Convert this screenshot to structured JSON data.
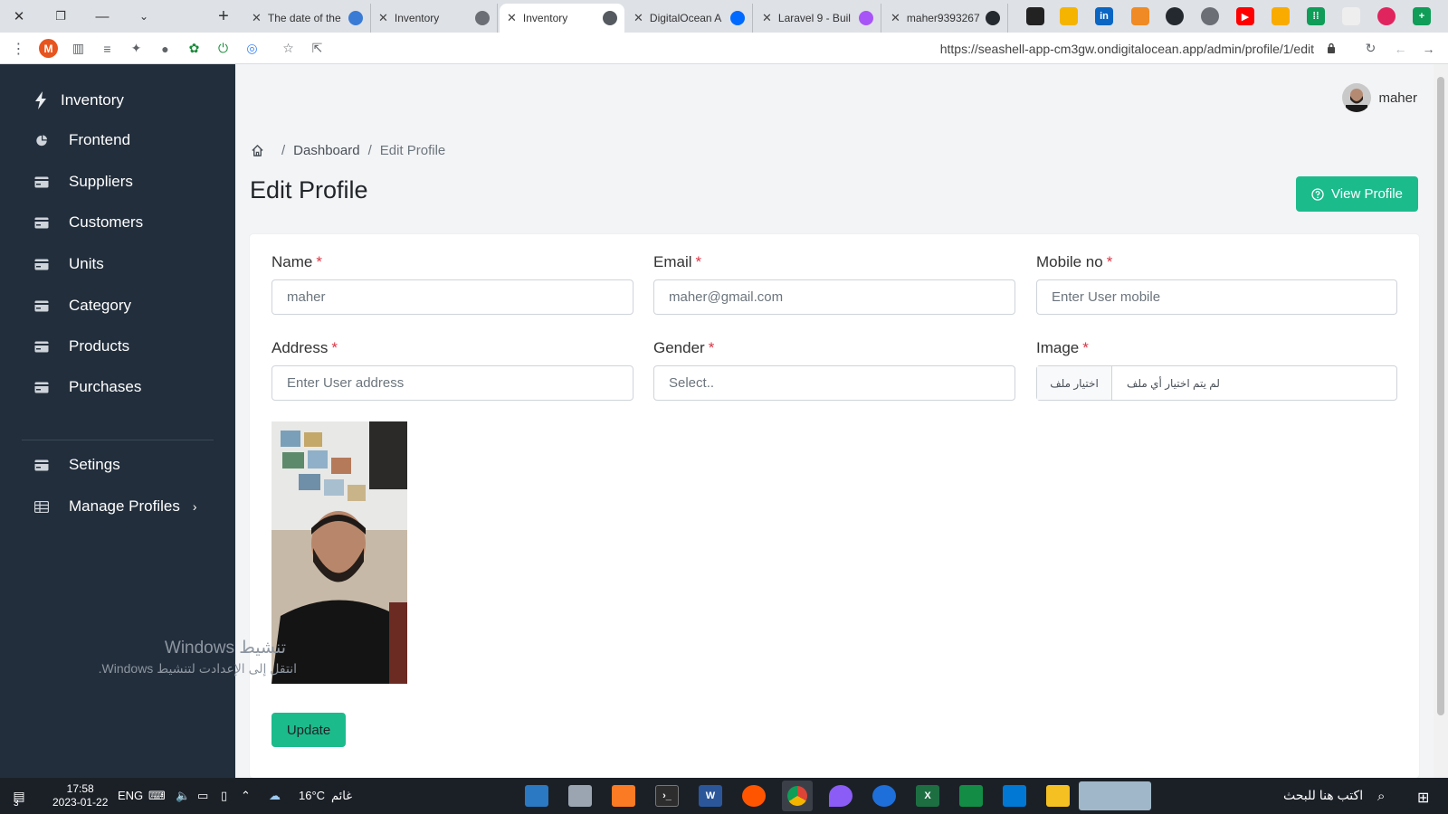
{
  "browser": {
    "tabs": [
      {
        "title": "The date of the"
      },
      {
        "title": "Inventory"
      },
      {
        "title": "Inventory",
        "active": true
      },
      {
        "title": "DigitalOcean A"
      },
      {
        "title": "Laravel 9 - Buil"
      },
      {
        "title": "maher9393267"
      }
    ],
    "new_tab": "+",
    "url": "https://seashell-app-cm3gw.ondigitalocean.app/admin/profile/1/edit",
    "profile_initial": "M"
  },
  "sidebar": {
    "brand": "Inventory",
    "items": [
      {
        "label": "Frontend",
        "icon": "pie-chart-icon"
      },
      {
        "label": "Suppliers",
        "icon": "card-icon"
      },
      {
        "label": "Customers",
        "icon": "card-icon"
      },
      {
        "label": "Units",
        "icon": "card-icon"
      },
      {
        "label": "Category",
        "icon": "card-icon"
      },
      {
        "label": "Products",
        "icon": "card-icon"
      },
      {
        "label": "Purchases",
        "icon": "card-icon"
      }
    ],
    "settings": {
      "label": "Setings"
    },
    "manage": {
      "label": "Manage Profiles",
      "chevron": "›"
    }
  },
  "watermark": {
    "line1": "تنشيط Windows",
    "line2": "انتقل إلى الإعدادت لتنشيط Windows."
  },
  "header": {
    "user_name": "maher"
  },
  "breadcrumb": {
    "items": [
      "Dashboard",
      "Edit Profile"
    ],
    "separator": "/"
  },
  "page": {
    "title": "Edit Profile",
    "view_profile": "View Profile"
  },
  "form": {
    "required_mark": "*",
    "name": {
      "label": "Name",
      "value": "maher"
    },
    "email": {
      "label": "Email",
      "value": "maher@gmail.com"
    },
    "mobile": {
      "label": "Mobile no",
      "placeholder": "Enter User mobile"
    },
    "address": {
      "label": "Address",
      "placeholder": "Enter User address"
    },
    "gender": {
      "label": "Gender",
      "selected": "Select.."
    },
    "image": {
      "label": "Image",
      "button": "اختيار ملف",
      "status": "لم يتم اختيار أي ملف"
    },
    "update": "Update"
  },
  "taskbar": {
    "time": "17:58",
    "date": "2023-01-22",
    "lang": "ENG",
    "temperature": "16°C",
    "weather": "غائم",
    "search_placeholder": "اكتب هنا للبحث",
    "notifications": "3"
  },
  "colors": {
    "sidebar_bg": "#222e3c",
    "primary": "#1cbb8c",
    "required": "#dc3545"
  }
}
